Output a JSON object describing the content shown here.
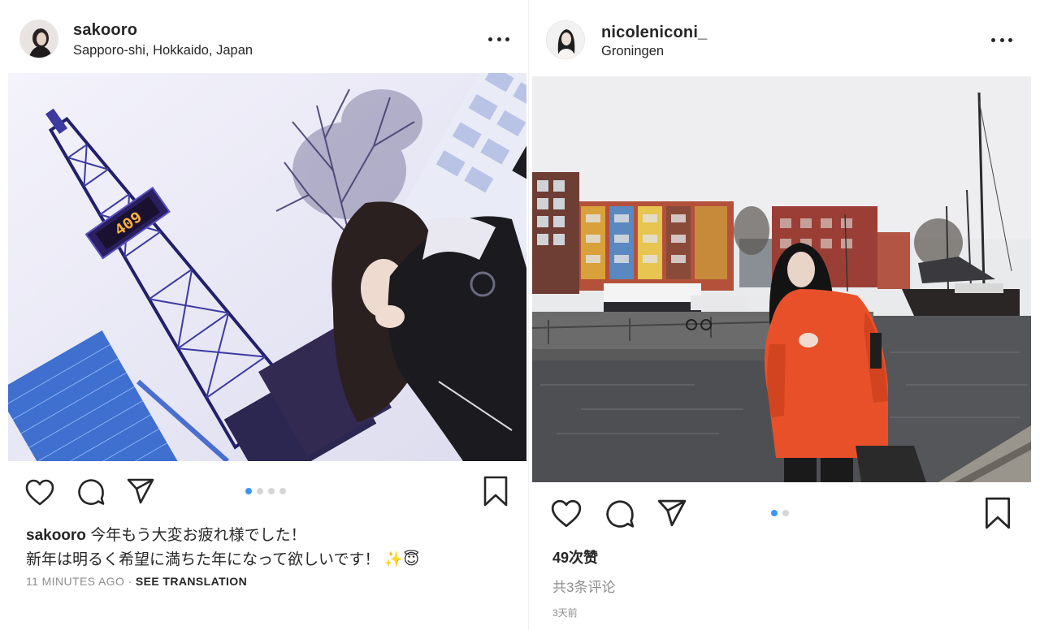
{
  "posts": [
    {
      "username": "sakooro",
      "location": "Sapporo-shi, Hokkaido, Japan",
      "photo_clock": "409",
      "carousel": {
        "count": 4,
        "active": 0
      },
      "caption": {
        "user": "sakooro",
        "line1": "今年もう大変お疲れ様でした！",
        "line2": "新年は明るく希望に満ちた年になって欲しいです！ ✨😇"
      },
      "time": "11 MINUTES AGO",
      "separator": "·",
      "see_translation": "SEE TRANSLATION"
    },
    {
      "username": "nicoleniconi_",
      "location": "Groningen",
      "carousel": {
        "count": 2,
        "active": 0
      },
      "likes": "49次赞",
      "comments": "共3条评论",
      "ago": "3天前"
    }
  ],
  "icons": {
    "like": "heart-icon",
    "comment": "comment-icon",
    "share": "paper-plane-icon",
    "save": "bookmark-icon",
    "more": "more-dots-icon"
  },
  "colors": {
    "text": "#262626",
    "muted": "#8e8e8e",
    "active_dot": "#3897f0",
    "inactive_dot": "#d6d6d6",
    "jacket": "#e8502a"
  }
}
